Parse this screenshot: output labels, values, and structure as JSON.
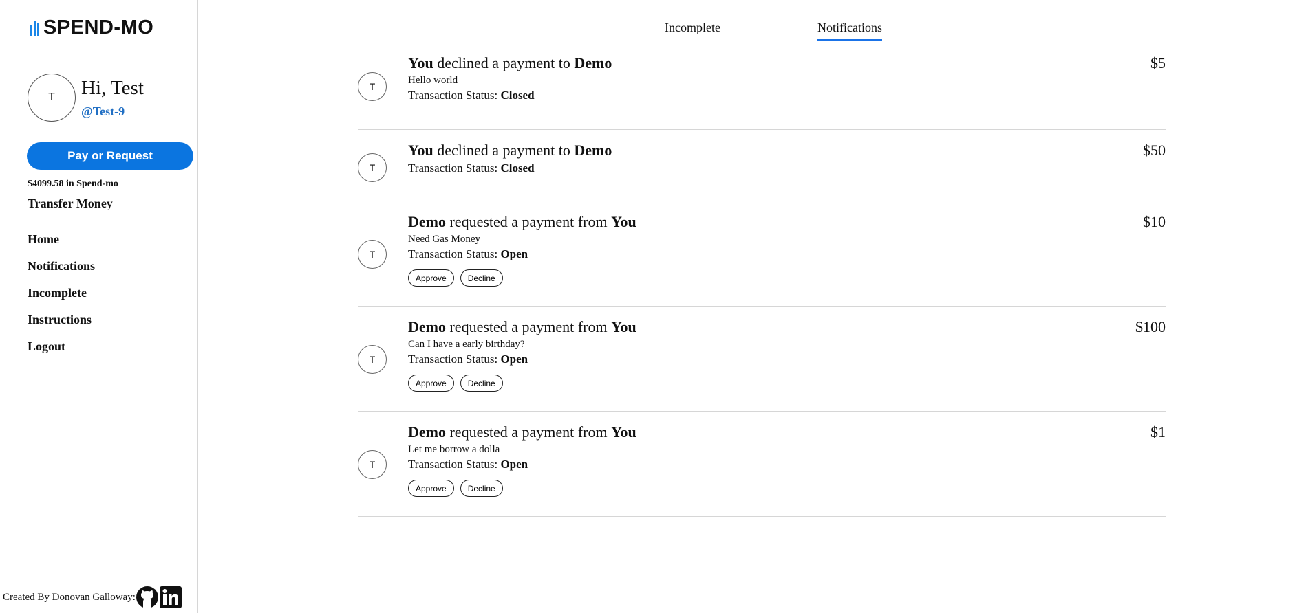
{
  "brand": {
    "name": "SPEND-MO",
    "color": "#1a86e8"
  },
  "user": {
    "initial": "T",
    "greeting": "Hi, Test",
    "handle": "@Test-9"
  },
  "actions": {
    "pay_label": "Pay or Request"
  },
  "balance_text": "$4099.58 in Spend-mo",
  "transfer_label": "Transfer Money",
  "nav": [
    {
      "label": "Home"
    },
    {
      "label": "Notifications"
    },
    {
      "label": "Incomplete"
    },
    {
      "label": "Instructions"
    },
    {
      "label": "Logout"
    }
  ],
  "footer": {
    "text": "Created By Donovan Galloway:",
    "icons": [
      "github-icon",
      "linkedin-icon"
    ]
  },
  "tabs": [
    {
      "label": "Incomplete",
      "active": false
    },
    {
      "label": "Notifications",
      "active": true
    }
  ],
  "notifications": [
    {
      "avatar": "T",
      "actor": "You",
      "verb": "declined a payment to",
      "target": "Demo",
      "note": "Hello world",
      "status_label": "Transaction Status:",
      "status": "Closed",
      "amount": "$5"
    },
    {
      "avatar": "T",
      "actor": "You",
      "verb": "declined a payment to",
      "target": "Demo",
      "note": "",
      "status_label": "Transaction Status:",
      "status": "Closed",
      "amount": "$50"
    },
    {
      "avatar": "T",
      "actor": "Demo",
      "verb": "requested a payment from",
      "target": "You",
      "note": "Need Gas Money",
      "status_label": "Transaction Status:",
      "status": "Open",
      "amount": "$10",
      "approve_label": "Approve",
      "decline_label": "Decline"
    },
    {
      "avatar": "T",
      "actor": "Demo",
      "verb": "requested a payment from",
      "target": "You",
      "note": "Can I have a early birthday?",
      "status_label": "Transaction Status:",
      "status": "Open",
      "amount": "$100",
      "approve_label": "Approve",
      "decline_label": "Decline"
    },
    {
      "avatar": "T",
      "actor": "Demo",
      "verb": "requested a payment from",
      "target": "You",
      "note": "Let me borrow a dolla",
      "status_label": "Transaction Status:",
      "status": "Open",
      "amount": "$1",
      "approve_label": "Approve",
      "decline_label": "Decline"
    }
  ]
}
